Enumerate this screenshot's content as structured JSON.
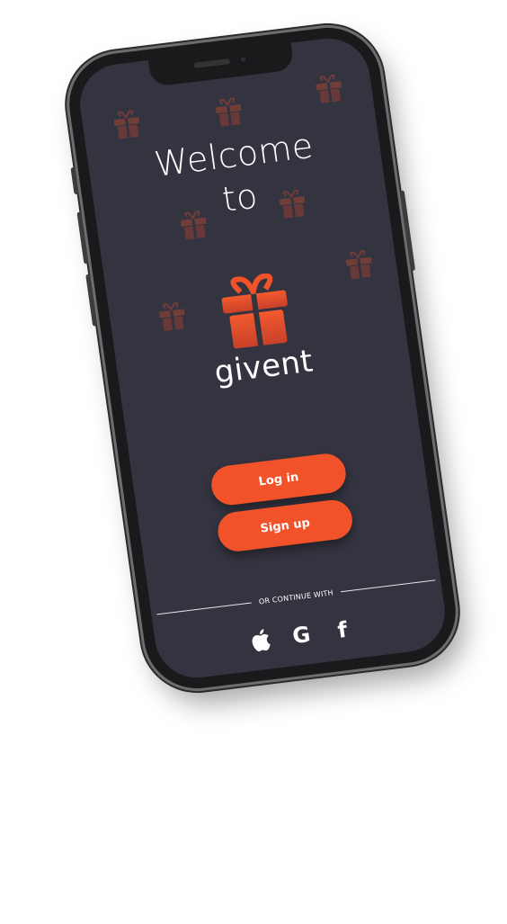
{
  "welcome": {
    "line1": "Welcome",
    "line2": "to"
  },
  "brand": {
    "name": "givent",
    "logo_icon": "gift-icon",
    "accent_color": "#f2522a"
  },
  "actions": {
    "login_label": "Log in",
    "signup_label": "Sign up"
  },
  "alt_login": {
    "divider_text": "OR CONTINUE WITH",
    "providers": [
      {
        "name": "Apple",
        "icon": "apple-icon"
      },
      {
        "name": "Google",
        "icon": "google-icon",
        "glyph": "G"
      },
      {
        "name": "Facebook",
        "icon": "facebook-icon",
        "glyph": "f"
      }
    ]
  },
  "colors": {
    "screen_bg": "#343440",
    "text": "#ffffff",
    "button": "#f2522a"
  }
}
